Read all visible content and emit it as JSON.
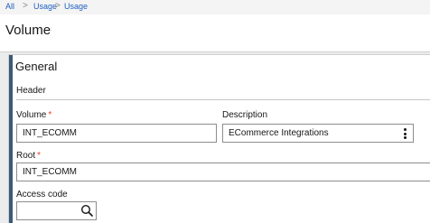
{
  "breadcrumb": {
    "items": [
      "All",
      "Usage",
      "Usage"
    ],
    "separator": ">"
  },
  "page": {
    "title": "Volume"
  },
  "section": {
    "title": "General"
  },
  "subsection": {
    "title": "Header"
  },
  "fields": {
    "volume": {
      "label": "Volume",
      "required_mark": "*",
      "value": "INT_ECOMM"
    },
    "description": {
      "label": "Description",
      "value": "ECommerce Integrations"
    },
    "root": {
      "label": "Root",
      "required_mark": "*",
      "value": "INT_ECOMM"
    },
    "access_code": {
      "label": "Access code",
      "value": ""
    }
  },
  "icons": {
    "more": "kebab-vertical-icon",
    "search": "magnifier-icon"
  },
  "colors": {
    "link": "#1f5fbf",
    "required": "#e0472f",
    "accent": "#3b5a78"
  }
}
